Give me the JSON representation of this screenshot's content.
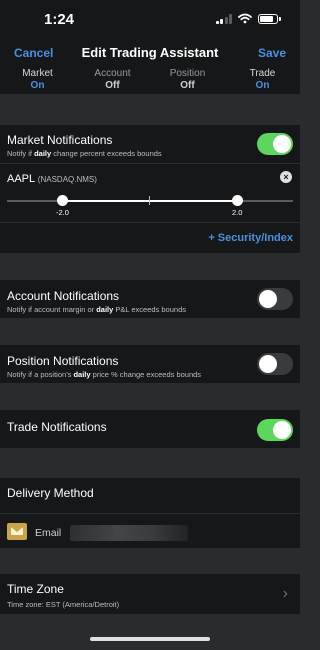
{
  "status": {
    "time": "1:24"
  },
  "nav": {
    "cancel": "Cancel",
    "title": "Edit Trading Assistant",
    "save": "Save"
  },
  "tabs": [
    {
      "label": "Market",
      "value": "On"
    },
    {
      "label": "Account",
      "value": "Off"
    },
    {
      "label": "Position",
      "value": "Off"
    },
    {
      "label": "Trade",
      "value": "On"
    }
  ],
  "market": {
    "title": "Market Notifications",
    "sub_pre": "Notify if ",
    "sub_bold": "daily",
    "sub_post": " change percent exceeds bounds",
    "toggle_on": true,
    "symbol": "AAPL",
    "exchange": "(NASDAQ.NMS)",
    "low": "-2.0",
    "high": "2.0",
    "add_label": "+ Security/Index"
  },
  "account": {
    "title": "Account Notifications",
    "sub_pre": "Notify if account margin or ",
    "sub_bold": "daily",
    "sub_post": " P&L exceeds bounds",
    "toggle_on": false
  },
  "position": {
    "title": "Position Notifications",
    "sub_pre": "Notify if a position's ",
    "sub_bold": "daily",
    "sub_post": " price % change exceeds bounds",
    "toggle_on": false
  },
  "trade": {
    "title": "Trade Notifications",
    "toggle_on": true
  },
  "delivery": {
    "title": "Delivery Method",
    "email_label": "Email"
  },
  "timezone": {
    "title": "Time Zone",
    "sub": "Time zone: EST (America/Detroit)"
  },
  "colors": {
    "accent": "#4a90e2",
    "toggle_on": "#5cd65c",
    "background": "#161718"
  },
  "icons": [
    "wifi-icon",
    "battery-icon",
    "close-icon",
    "email-icon",
    "chevron-right-icon"
  ]
}
